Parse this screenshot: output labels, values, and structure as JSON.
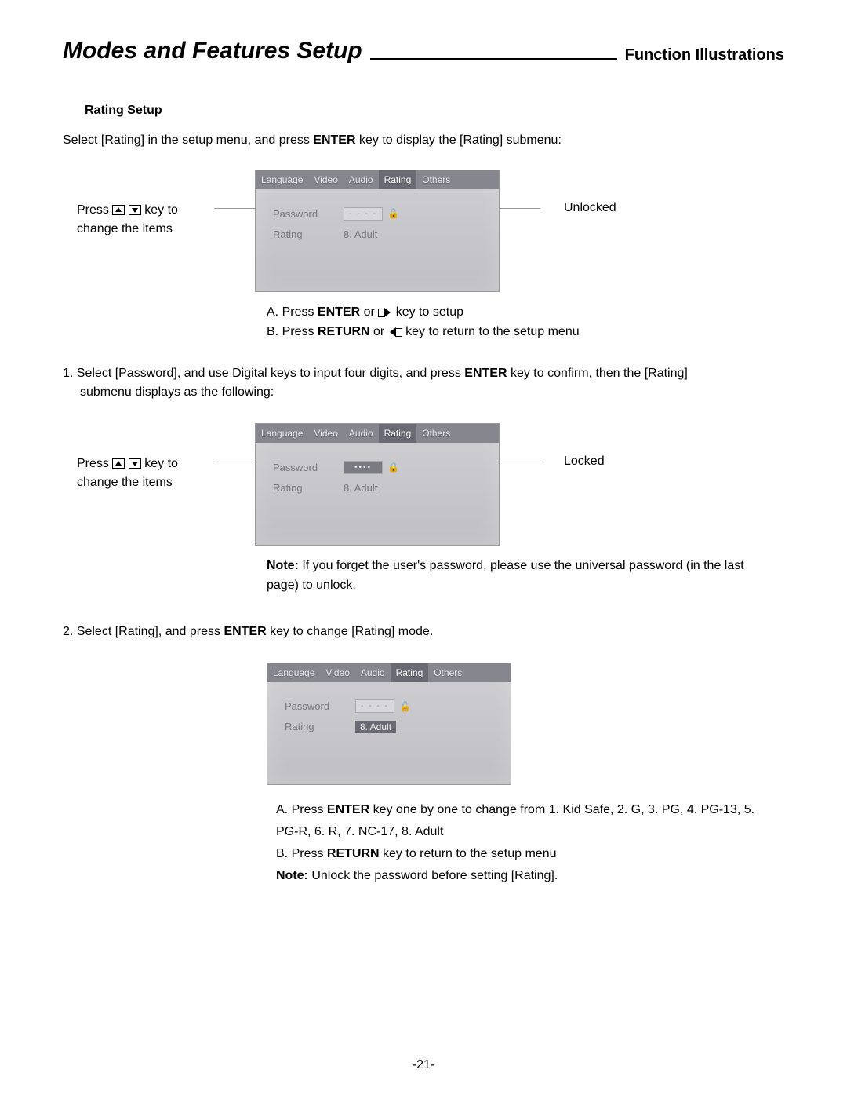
{
  "header": {
    "main_title": "Modes and Features Setup",
    "sub_title": "Function Illustrations"
  },
  "section_label": "Rating Setup",
  "intro_before": "Select [Rating] in the setup menu, and press ",
  "intro_bold": "ENTER",
  "intro_after": " key to display the [Rating] submenu:",
  "side_note_line1_a": "Press ",
  "side_note_line1_b": " key to",
  "side_note_line2": "change the items",
  "status_unlocked": "Unlocked",
  "status_locked": "Locked",
  "osd": {
    "tabs": [
      "Language",
      "Video",
      "Audio",
      "Rating",
      "Others"
    ],
    "password_label": "Password",
    "rating_label": "Rating",
    "rating_value": "8. Adult",
    "pw_dashes": "- - - -",
    "pw_dots": "••••"
  },
  "under1_A_pre": "A. Press ",
  "under1_A_bold": "ENTER",
  "under1_A_mid": " or ",
  "under1_A_post": " key to setup",
  "under1_B_pre": "B. Press ",
  "under1_B_bold": "RETURN",
  "under1_B_mid": " or ",
  "under1_B_post": " key to return to the setup menu",
  "step1_num": "1. ",
  "step1_a": "Select [Password], and use Digital keys to input four digits, and press ",
  "step1_bold": "ENTER",
  "step1_b": " key to confirm, then the [Rating]",
  "step1_c": "submenu displays as the following:",
  "note1_bold": "Note:",
  "note1_text": " If you forget the user's password, please use the universal password (in the last page) to unlock.",
  "step2_num": "2. ",
  "step2_a": "Select [Rating], and press ",
  "step2_bold": "ENTER",
  "step2_b": " key to change [Rating] mode.",
  "under3_A_pre": "A. Press ",
  "under3_A_bold": "ENTER",
  "under3_A_post": " key one by one to change from 1. Kid Safe, 2. G, 3. PG, 4. PG-13, 5. PG-R, 6. R, 7. NC-17, 8. Adult",
  "under3_B_pre": "B. Press ",
  "under3_B_bold": "RETURN",
  "under3_B_post": " key to return to the setup menu",
  "under3_note_bold": "Note:",
  "under3_note_text": " Unlock the password before setting [Rating].",
  "page_number": "-21-"
}
